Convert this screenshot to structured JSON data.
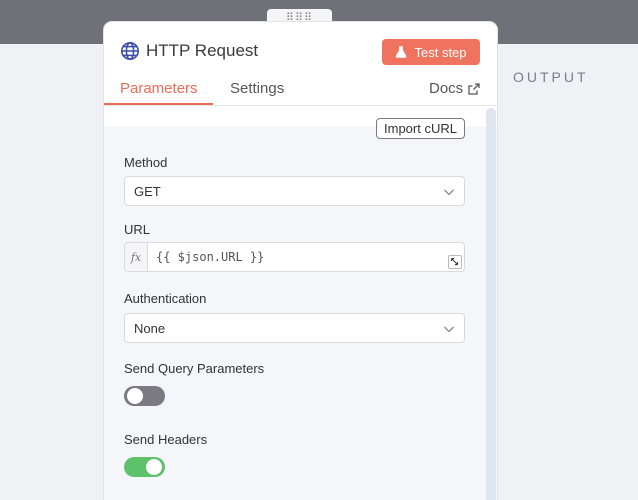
{
  "canvas": {
    "output_label": "OUTPUT"
  },
  "node": {
    "title": "HTTP Request",
    "test_step_label": "Test step"
  },
  "tabs": [
    {
      "label": "Parameters",
      "active": true
    },
    {
      "label": "Settings",
      "active": false
    }
  ],
  "docs_label": "Docs",
  "import_curl_label": "Import cURL",
  "fields": {
    "method": {
      "label": "Method",
      "value": "GET"
    },
    "url": {
      "label": "URL",
      "value": "{{ $json.URL }}",
      "expression_icon": "fx"
    },
    "authentication": {
      "label": "Authentication",
      "value": "None"
    },
    "send_query_parameters": {
      "label": "Send Query Parameters",
      "enabled": false
    },
    "send_headers": {
      "label": "Send Headers",
      "enabled": true
    }
  },
  "colors": {
    "accent": "#ee6b55",
    "test_button": "#f0735f",
    "toggle_on": "#5ec26a",
    "toggle_off": "#7a7a80",
    "globe_icon": "#3d4fa8"
  },
  "icons": {
    "node": "globe-icon",
    "test_step": "flask-icon",
    "docs": "external-link-icon",
    "select": "chevron-down-icon",
    "url_expand": "expand-icon"
  }
}
